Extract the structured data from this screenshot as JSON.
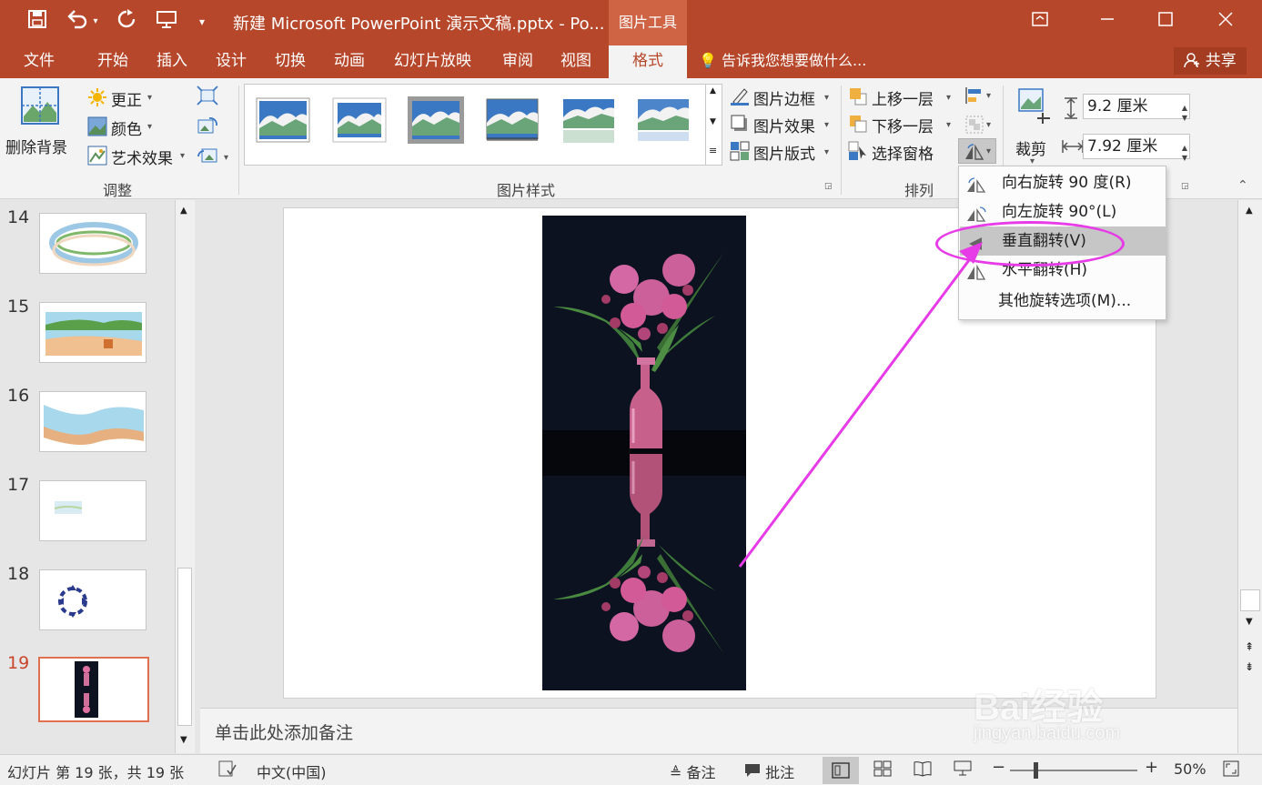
{
  "titlebar": {
    "title": "新建 Microsoft PowerPoint 演示文稿.pptx - Po...",
    "context_tool": "图片工具"
  },
  "tabs": [
    {
      "label": "文件"
    },
    {
      "label": "开始"
    },
    {
      "label": "插入"
    },
    {
      "label": "设计"
    },
    {
      "label": "切换"
    },
    {
      "label": "动画"
    },
    {
      "label": "幻灯片放映"
    },
    {
      "label": "审阅"
    },
    {
      "label": "视图"
    },
    {
      "label": "格式"
    }
  ],
  "tellme": "告诉我您想要做什么...",
  "share": "共享",
  "ribbon": {
    "adjust": {
      "remove_bg": "删除背景",
      "correct": "更正",
      "color": "颜色",
      "artistic": "艺术效果",
      "group": "调整"
    },
    "styles": {
      "border": "图片边框",
      "effects": "图片效果",
      "layout": "图片版式",
      "group": "图片样式"
    },
    "arrange": {
      "bring_forward": "上移一层",
      "send_backward": "下移一层",
      "selection_pane": "选择窗格",
      "group": "排列"
    },
    "size": {
      "crop": "裁剪",
      "height": "9.2 厘米",
      "width": "7.92 厘米"
    }
  },
  "rotate_menu": {
    "rotate_right": "向右旋转 90 度(R)",
    "rotate_left": "向左旋转 90°(L)",
    "flip_vertical": "垂直翻转(V)",
    "flip_horizontal": "水平翻转(H)",
    "more": "其他旋转选项(M)..."
  },
  "slides": [
    {
      "num": "14"
    },
    {
      "num": "15"
    },
    {
      "num": "16"
    },
    {
      "num": "17"
    },
    {
      "num": "18"
    },
    {
      "num": "19"
    }
  ],
  "notes_placeholder": "单击此处添加备注",
  "status": {
    "slide_info": "幻灯片 第 19 张，共 19 张",
    "language": "中文(中国)",
    "notes": "备注",
    "comments": "批注",
    "zoom": "50%"
  },
  "watermark": {
    "brand": "Bai经验",
    "url": "jingyan.baidu.com"
  },
  "colors": {
    "accent": "#b7472a",
    "highlight": "#e63be6"
  }
}
